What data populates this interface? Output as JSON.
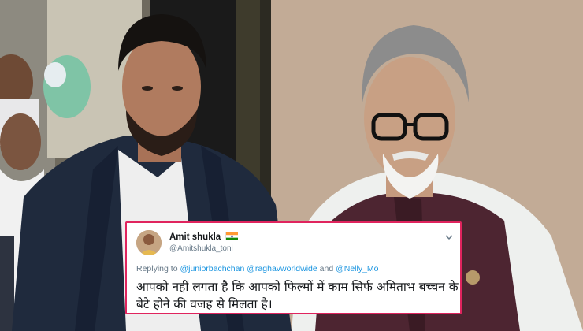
{
  "tweet": {
    "name": "Amit shukla",
    "handle": "@Amitshukla_toni",
    "replying_to_prefix": "Replying to",
    "mention_1": "@juniorbachchan",
    "mention_2": "@raghavworldwide",
    "and_word": "and",
    "mention_3": "@Nelly_Mo",
    "text": "आपको नहीं लगता है कि आपको फिल्मों में काम सिर्फ अमिताभ बच्चन के बेटे होने की वजह से मिलता है।",
    "flag_icon": "india-flag-icon",
    "menu_icon": "chevron-down-icon",
    "border_color": "#e0245e",
    "mention_color": "#1b95e0"
  }
}
